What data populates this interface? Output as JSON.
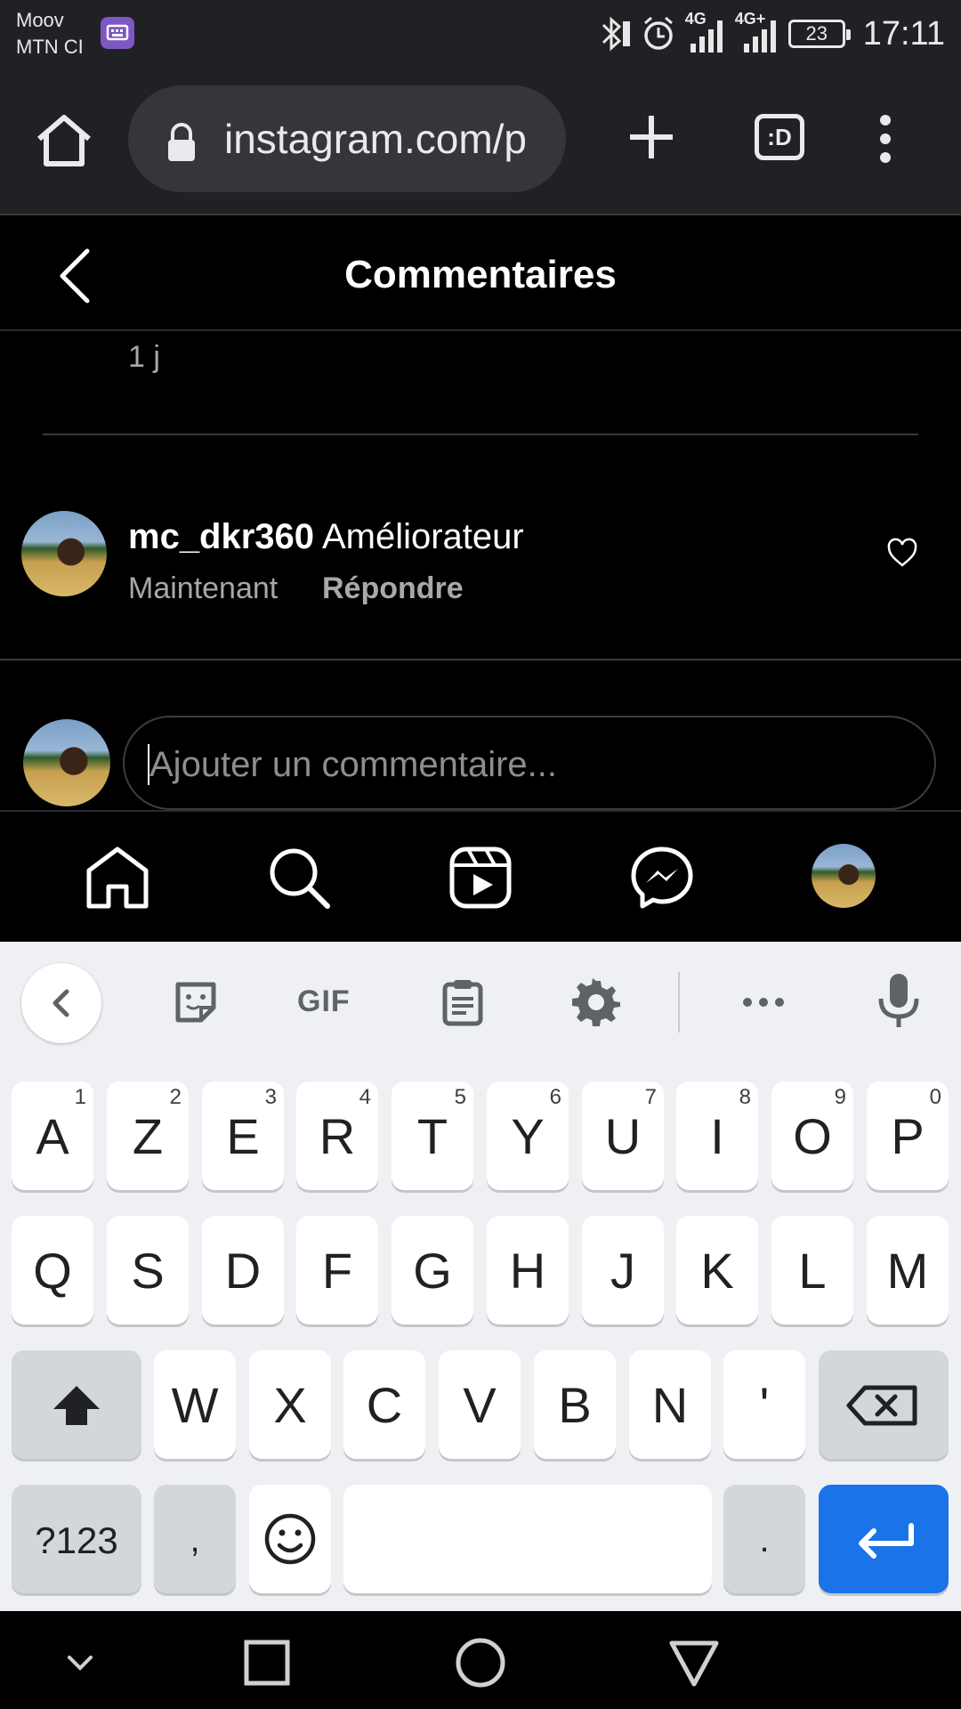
{
  "status_bar": {
    "carrier_line1": "Moov",
    "carrier_line2": "MTN CI",
    "net1": "4G",
    "net2": "4G+",
    "battery": "23",
    "time": "17:11"
  },
  "browser": {
    "url": "instagram.com/p",
    "tabs_label": ":D"
  },
  "header": {
    "title": "Commentaires"
  },
  "comments": {
    "previous_time": "1 j",
    "items": [
      {
        "username": "mc_dkr360",
        "text": "Améliorateur",
        "time": "Maintenant",
        "reply": "Répondre"
      }
    ]
  },
  "add_comment": {
    "placeholder": "Ajouter un commentaire..."
  },
  "keyboard": {
    "toolbar": {
      "gif": "GIF"
    },
    "row1": [
      {
        "k": "A",
        "n": "1"
      },
      {
        "k": "Z",
        "n": "2"
      },
      {
        "k": "E",
        "n": "3"
      },
      {
        "k": "R",
        "n": "4"
      },
      {
        "k": "T",
        "n": "5"
      },
      {
        "k": "Y",
        "n": "6"
      },
      {
        "k": "U",
        "n": "7"
      },
      {
        "k": "I",
        "n": "8"
      },
      {
        "k": "O",
        "n": "9"
      },
      {
        "k": "P",
        "n": "0"
      }
    ],
    "row2": [
      "Q",
      "S",
      "D",
      "F",
      "G",
      "H",
      "J",
      "K",
      "L",
      "M"
    ],
    "row3": [
      "W",
      "X",
      "C",
      "V",
      "B",
      "N",
      "'"
    ],
    "symbols": "?123",
    "comma": ",",
    "period": "."
  }
}
